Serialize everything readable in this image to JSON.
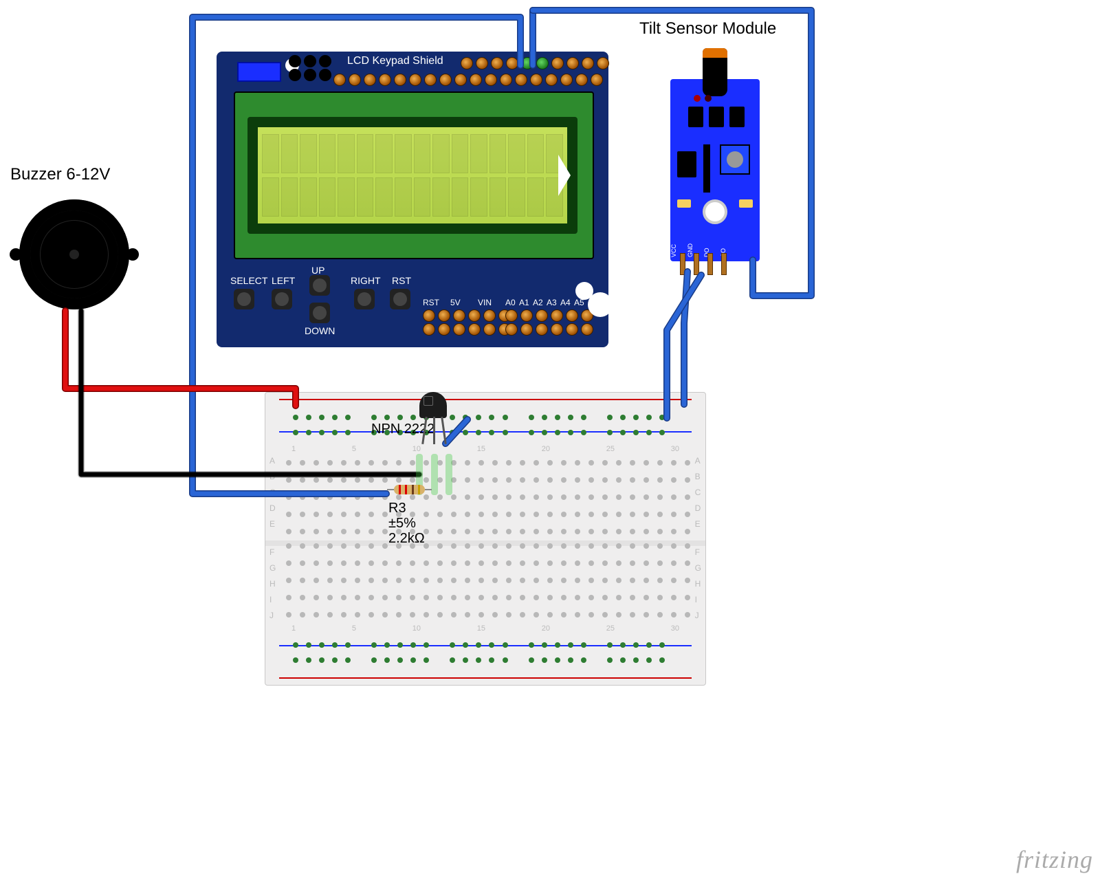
{
  "labels": {
    "buzzer": "Buzzer 6-12V",
    "tilt": "Tilt Sensor Module",
    "shield_title": "LCD Keypad Shield",
    "npn": "NPN 2222",
    "resistor_name": "R3",
    "resistor_tol": "±5%",
    "resistor_value": "2.2kΩ",
    "footer": "fritzing"
  },
  "shield_buttons": {
    "select": "SELECT",
    "left": "LEFT",
    "up": "UP",
    "down": "DOWN",
    "right": "RIGHT",
    "rst": "RST"
  },
  "shield_bottom_pins": {
    "rst2": "RST",
    "v5": "5V",
    "vin": "VIN",
    "a0": "A0",
    "a1": "A1",
    "a2": "A2",
    "a3": "A3",
    "a4": "A4",
    "a5": "A5"
  },
  "tilt_pins": {
    "vcc": "VCC",
    "gnd": "GND",
    "do": "DO",
    "ao": "AO"
  },
  "breadboard": {
    "rows_top": [
      "A",
      "B",
      "C",
      "D",
      "E"
    ],
    "rows_bot": [
      "F",
      "G",
      "H",
      "I",
      "J"
    ],
    "col_marks": [
      "1",
      "5",
      "10",
      "15",
      "20",
      "25",
      "30"
    ]
  },
  "resistor_bands": [
    "red",
    "red",
    "red",
    "gold"
  ],
  "components": [
    {
      "name": "LCD Keypad Shield",
      "type": "shield"
    },
    {
      "name": "Tilt Sensor Module",
      "type": "sensor",
      "pins": [
        "VCC",
        "GND",
        "DO",
        "AO"
      ]
    },
    {
      "name": "Buzzer",
      "voltage": "6-12V",
      "type": "buzzer"
    },
    {
      "name": "NPN 2222",
      "type": "transistor",
      "package": "TO-92"
    },
    {
      "name": "R3",
      "type": "resistor",
      "value": "2.2kΩ",
      "tolerance": "±5%"
    }
  ]
}
